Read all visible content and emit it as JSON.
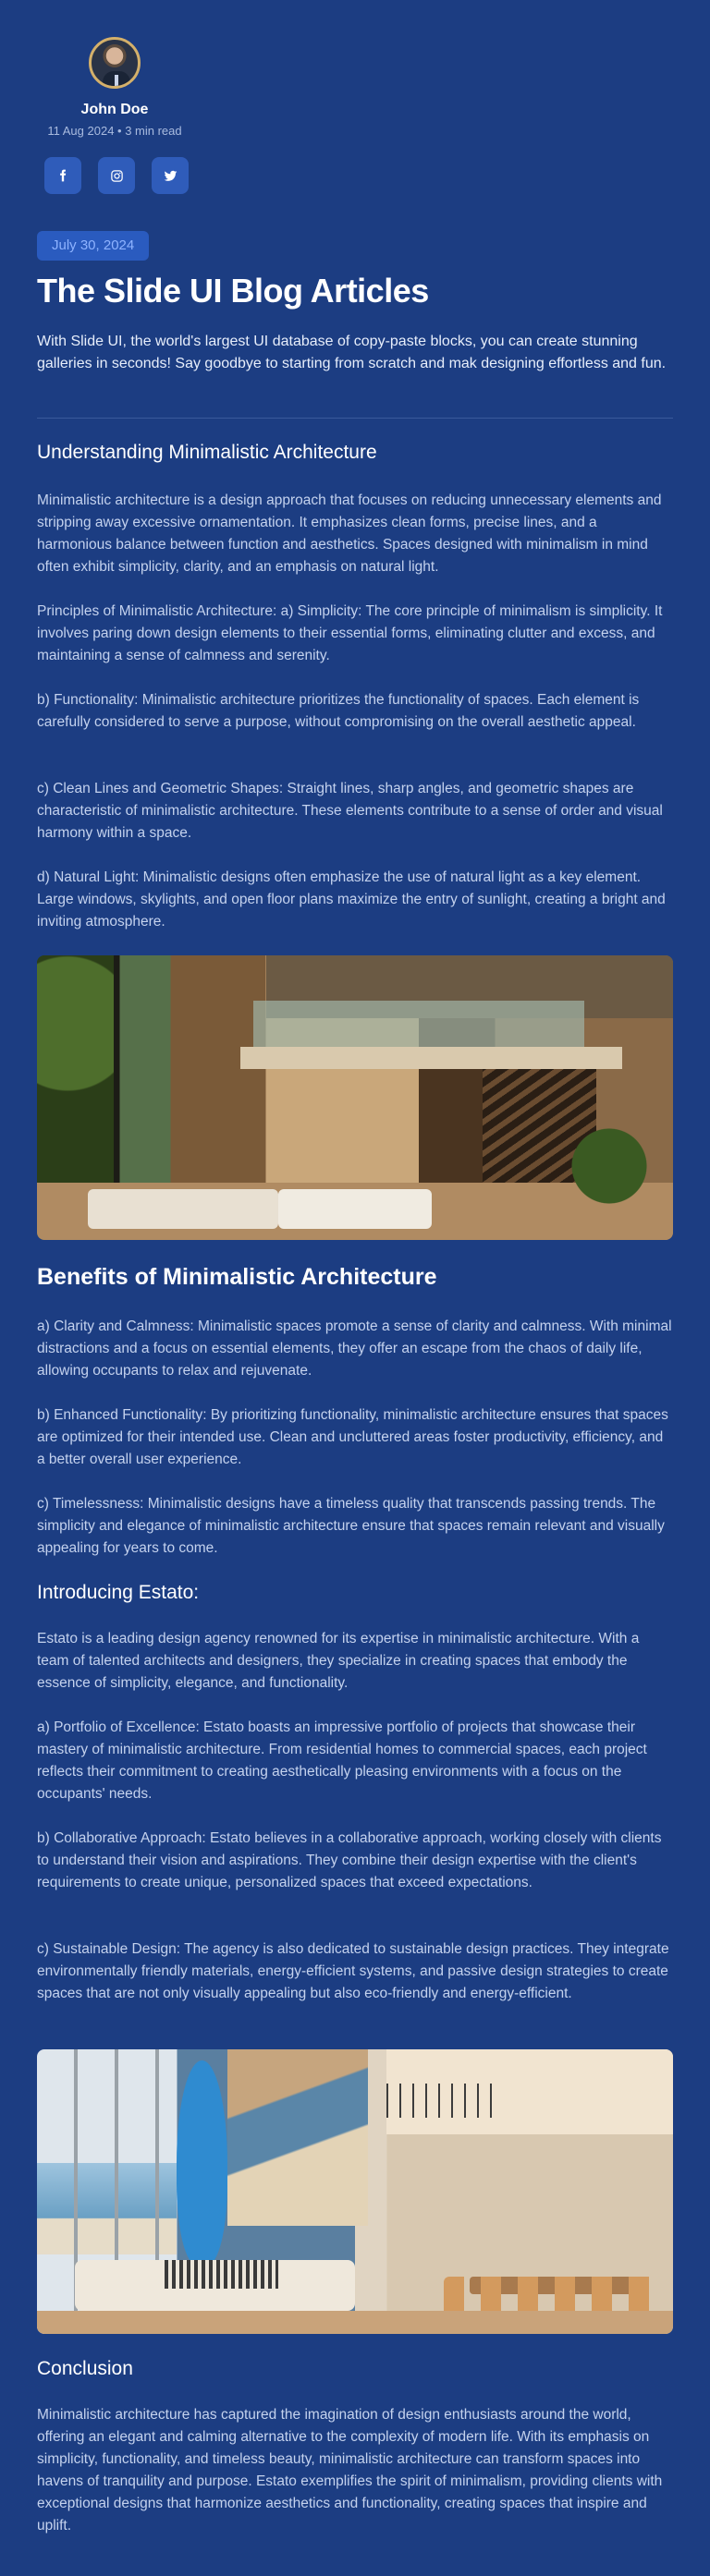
{
  "author": {
    "name": "John Doe",
    "meta": "11 Aug 2024 • 3 min read"
  },
  "socials": [
    {
      "icon": "facebook-icon",
      "glyph": "f"
    },
    {
      "icon": "instagram-icon",
      "glyph": ""
    },
    {
      "icon": "twitter-icon",
      "glyph": ""
    }
  ],
  "article": {
    "date": "July 30, 2024",
    "title": "The Slide UI Blog Articles",
    "intro": "With Slide UI, the world's largest UI database of copy-paste blocks, you can create stunning galleries in seconds! Say goodbye to starting from scratch and mak designing effortless and fun.",
    "section1": {
      "heading": "Understanding Minimalistic Architecture",
      "p1": "Minimalistic architecture is a design approach that focuses on reducing unnecessary elements and stripping away excessive ornamentation. It emphasizes clean forms, precise lines, and a harmonious balance between function and aesthetics. Spaces designed with minimalism in mind often exhibit simplicity, clarity, and an emphasis on natural light.",
      "p2": "Principles of Minimalistic Architecture: a) Simplicity: The core principle of minimalism is simplicity. It involves paring down design elements to their essential forms, eliminating clutter and excess, and maintaining a sense of calmness and serenity.",
      "p3": "b) Functionality: Minimalistic architecture prioritizes the functionality of spaces. Each element is carefully considered to serve a purpose, without compromising on the overall aesthetic appeal.",
      "p4": "c) Clean Lines and Geometric Shapes: Straight lines, sharp angles, and geometric shapes are characteristic of minimalistic architecture. These elements contribute to a sense of order and visual harmony within a space.",
      "p5": "d) Natural Light: Minimalistic designs often emphasize the use of natural light as a key element. Large windows, skylights, and open floor plans maximize the entry of sunlight, creating a bright and inviting atmosphere."
    },
    "section2": {
      "heading": "Benefits of Minimalistic Architecture",
      "p1": "a) Clarity and Calmness: Minimalistic spaces promote a sense of clarity and calmness. With minimal distractions and a focus on essential elements, they offer an escape from the chaos of daily life, allowing occupants to relax and rejuvenate.",
      "p2": "b) Enhanced Functionality: By prioritizing functionality, minimalistic architecture ensures that spaces are optimized for their intended use. Clean and uncluttered areas foster productivity, efficiency, and a better overall user experience.",
      "p3": "c) Timelessness: Minimalistic designs have a timeless quality that transcends passing trends. The simplicity and elegance of minimalistic architecture ensure that spaces remain relevant and visually appealing for years to come."
    },
    "section3": {
      "heading": "Introducing Estato:",
      "p1": "Estato is a leading design agency renowned for its expertise in minimalistic architecture. With a team of talented architects and designers, they specialize in creating spaces that embody the essence of simplicity, elegance, and functionality.",
      "p2": "a) Portfolio of Excellence: Estato boasts an impressive portfolio of projects that showcase their mastery of minimalistic architecture. From residential homes to commercial spaces, each project reflects their commitment to creating aesthetically pleasing environments with a focus on the occupants' needs.",
      "p3": "b) Collaborative Approach: Estato believes in a collaborative approach, working closely with clients to understand their vision and aspirations. They combine their design expertise with the client's requirements to create unique, personalized spaces that exceed expectations.",
      "p4": "c) Sustainable Design: The agency is also dedicated to sustainable design practices. They integrate environmentally friendly materials, energy-efficient systems, and passive design strategies to create spaces that are not only visually appealing but also eco-friendly and energy-efficient."
    },
    "conclusion": {
      "heading": "Conclusion",
      "p1": "Minimalistic architecture has captured the imagination of design enthusiasts around the world, offering an elegant and calming alternative to the complexity of modern life. With its emphasis on simplicity, functionality, and timeless beauty, minimalistic architecture can transform spaces into havens of tranquility and purpose. Estato exemplifies the spirit of minimalism, providing clients with exceptional designs that harmonize aesthetics and functionality, creating spaces that inspire and uplift."
    }
  }
}
